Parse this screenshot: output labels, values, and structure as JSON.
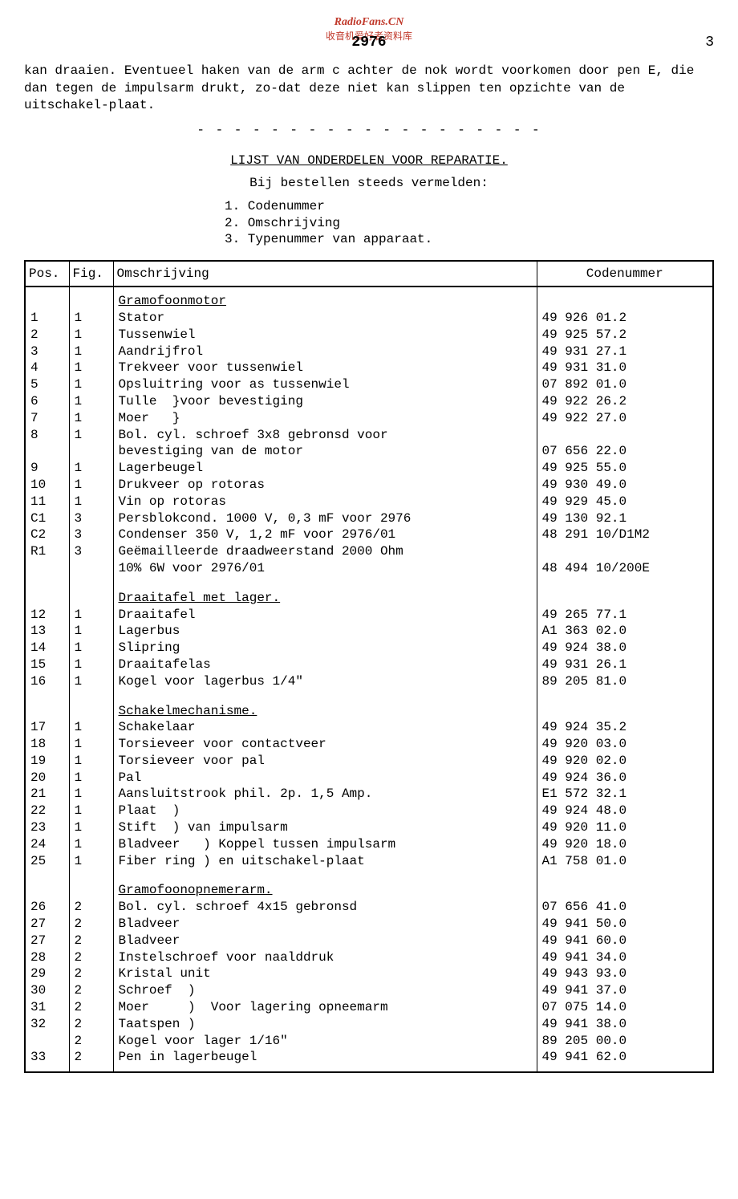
{
  "watermark": {
    "line1": "RadioFans.CN",
    "line2": "收音机爱好者资料库"
  },
  "header": {
    "center_num": "2976",
    "right_num": "3"
  },
  "intro": "kan draaien. Eventueel haken van de arm c achter de nok wordt voorkomen door pen E, die dan tegen de impulsarm drukt, zo-dat deze niet kan slippen ten opzichte van de uitschakel-plaat.",
  "divider": "- - - - - - - - - - - - - - - - - - -",
  "section_title": "LIJST VAN ONDERDELEN VOOR REPARATIE.",
  "sub_title": "Bij bestellen steeds vermelden:",
  "list": {
    "item1": "1. Codenummer",
    "item2": "2. Omschrijving",
    "item3": "3. Typenummer van apparaat."
  },
  "table": {
    "headers": {
      "pos": "Pos.",
      "fig": "Fig.",
      "desc": "Omschrijving",
      "code": "Codenummer"
    },
    "sections": [
      {
        "title": "Gramofoonmotor",
        "rows": [
          {
            "pos": "1",
            "fig": "1",
            "desc": "Stator",
            "code": "49 926 01.2"
          },
          {
            "pos": "2",
            "fig": "1",
            "desc": "Tussenwiel",
            "code": "49 925 57.2"
          },
          {
            "pos": "3",
            "fig": "1",
            "desc": "Aandrijfrol",
            "code": "49 931 27.1"
          },
          {
            "pos": "4",
            "fig": "1",
            "desc": "Trekveer voor tussenwiel",
            "code": "49 931 31.0"
          },
          {
            "pos": "5",
            "fig": "1",
            "desc": "Opsluitring voor as tussenwiel",
            "code": "07 892 01.0"
          },
          {
            "pos": "6",
            "fig": "1",
            "desc": "Tulle  }voor bevestiging",
            "code": "49 922 26.2"
          },
          {
            "pos": "7",
            "fig": "1",
            "desc": "Moer   }",
            "code": "49 922 27.0"
          },
          {
            "pos": "8",
            "fig": "1",
            "desc": "Bol. cyl. schroef 3x8 gebronsd voor",
            "code": ""
          },
          {
            "pos": "",
            "fig": "",
            "desc": "bevestiging van de motor",
            "code": "07 656 22.0"
          },
          {
            "pos": "9",
            "fig": "1",
            "desc": "Lagerbeugel",
            "code": "49 925 55.0"
          },
          {
            "pos": "10",
            "fig": "1",
            "desc": "Drukveer op rotoras",
            "code": "49 930 49.0"
          },
          {
            "pos": "11",
            "fig": "1",
            "desc": "Vin op rotoras",
            "code": "49 929 45.0"
          },
          {
            "pos": "C1",
            "fig": "3",
            "desc": "Persblokcond. 1000 V, 0,3 mF voor 2976",
            "code": "49 130 92.1"
          },
          {
            "pos": "C2",
            "fig": "3",
            "desc": "Condenser 350 V, 1,2 mF voor 2976/01",
            "code": "48 291 10/D1M2"
          },
          {
            "pos": "R1",
            "fig": "3",
            "desc": "Geëmailleerde draadweerstand 2000 Ohm",
            "code": ""
          },
          {
            "pos": "",
            "fig": "",
            "desc": "10% 6W voor 2976/01",
            "code": "48 494 10/200E"
          }
        ]
      },
      {
        "title": "Draaitafel met lager.",
        "rows": [
          {
            "pos": "12",
            "fig": "1",
            "desc": "Draaitafel",
            "code": "49 265 77.1"
          },
          {
            "pos": "13",
            "fig": "1",
            "desc": "Lagerbus",
            "code": "A1 363 02.0"
          },
          {
            "pos": "14",
            "fig": "1",
            "desc": "Slipring",
            "code": "49 924 38.0"
          },
          {
            "pos": "15",
            "fig": "1",
            "desc": "Draaitafelas",
            "code": "49 931 26.1"
          },
          {
            "pos": "16",
            "fig": "1",
            "desc": "Kogel voor lagerbus 1/4\"",
            "code": "89 205 81.0"
          }
        ]
      },
      {
        "title": "Schakelmechanisme.",
        "rows": [
          {
            "pos": "17",
            "fig": "1",
            "desc": "Schakelaar",
            "code": "49 924 35.2"
          },
          {
            "pos": "18",
            "fig": "1",
            "desc": "Torsieveer voor contactveer",
            "code": "49 920 03.0"
          },
          {
            "pos": "19",
            "fig": "1",
            "desc": "Torsieveer voor pal",
            "code": "49 920 02.0"
          },
          {
            "pos": "20",
            "fig": "1",
            "desc": "Pal",
            "code": "49 924 36.0"
          },
          {
            "pos": "21",
            "fig": "1",
            "desc": "Aansluitstrook phil. 2p. 1,5 Amp.",
            "code": "E1 572 32.1"
          },
          {
            "pos": "22",
            "fig": "1",
            "desc": "Plaat  )",
            "code": "49 924 48.0"
          },
          {
            "pos": "23",
            "fig": "1",
            "desc": "Stift  ) van impulsarm",
            "code": "49 920 11.0"
          },
          {
            "pos": "24",
            "fig": "1",
            "desc": "Bladveer   ) Koppel tussen impulsarm",
            "code": "49 920 18.0"
          },
          {
            "pos": "25",
            "fig": "1",
            "desc": "Fiber ring ) en uitschakel-plaat",
            "code": "A1 758 01.0"
          }
        ]
      },
      {
        "title": "Gramofoonopnemerarm.",
        "rows": [
          {
            "pos": "26",
            "fig": "2",
            "desc": "Bol. cyl. schroef 4x15 gebronsd",
            "code": "07 656 41.0"
          },
          {
            "pos": "27",
            "fig": "2",
            "desc": "Bladveer",
            "code": "49 941 50.0"
          },
          {
            "pos": "27",
            "fig": "2",
            "desc": "Bladveer",
            "code": "49 941 60.0"
          },
          {
            "pos": "28",
            "fig": "2",
            "desc": "Instelschroef voor naalddruk",
            "code": "49 941 34.0"
          },
          {
            "pos": "29",
            "fig": "2",
            "desc": "Kristal unit",
            "code": "49 943 93.0"
          },
          {
            "pos": "30",
            "fig": "2",
            "desc": "Schroef  )",
            "code": "49 941 37.0"
          },
          {
            "pos": "31",
            "fig": "2",
            "desc": "Moer     )  Voor lagering opneemarm",
            "code": "07 075 14.0"
          },
          {
            "pos": "32",
            "fig": "2",
            "desc": "Taatspen )",
            "code": "49 941 38.0"
          },
          {
            "pos": "",
            "fig": "2",
            "desc": "Kogel voor lager 1/16\"",
            "code": "89 205 00.0"
          },
          {
            "pos": "33",
            "fig": "2",
            "desc": "Pen in lagerbeugel",
            "code": "49 941 62.0"
          }
        ]
      }
    ]
  }
}
